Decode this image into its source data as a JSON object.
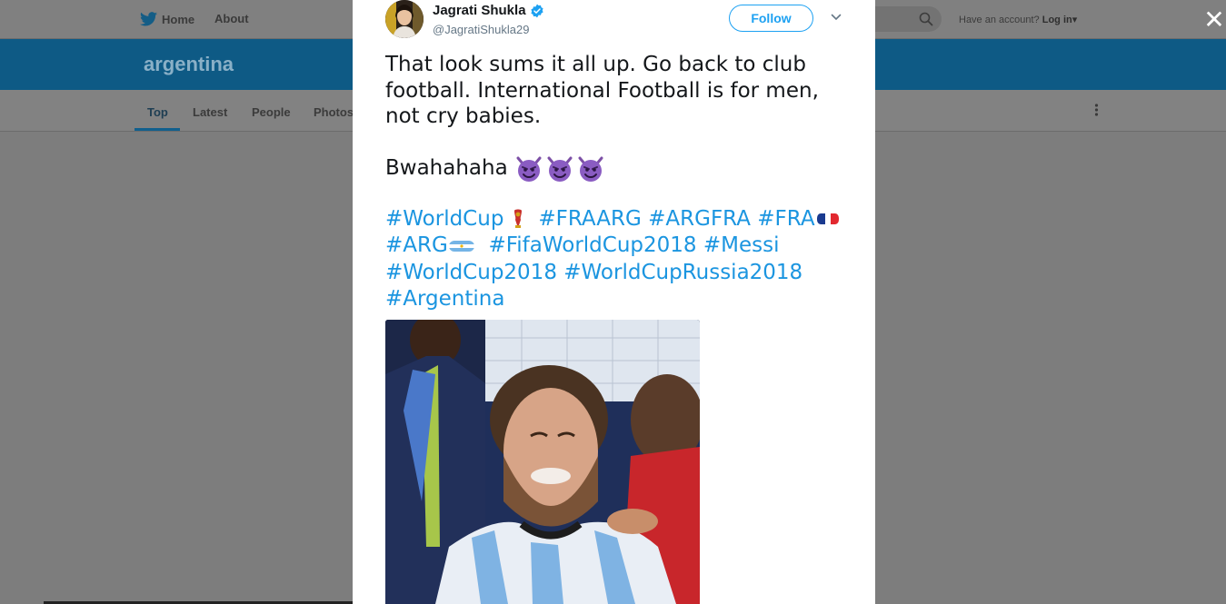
{
  "topnav": {
    "home_label": "Home",
    "about_label": "About",
    "account_prompt": "Have an account?",
    "login_label": "Log in"
  },
  "search": {
    "title": "argentina",
    "tabs": [
      "Top",
      "Latest",
      "People",
      "Photos"
    ],
    "active_tab": "Top"
  },
  "tweet": {
    "author_name": "Jagrati Shukla",
    "author_handle": "@JagratiShukla29",
    "follow_label": "Follow",
    "text_line1": "That look sums it all up. Go back to club football. International Football is for men, not cry babies.",
    "text_line2": "Bwahahaha",
    "emoji_count": 3,
    "hashtags": {
      "worldcup": "#WorldCup",
      "fraarg": "#FRAARG",
      "argfra": "#ARGFRA",
      "fra": "#FRA",
      "arg": "#ARG",
      "fifa2018": "#FifaWorldCup2018",
      "messi": "#Messi",
      "worldcup2018": "#WorldCup2018",
      "russia2018": "#WorldCupRussia2018",
      "argentina": "#Argentina"
    }
  },
  "colors": {
    "accent": "#1da1f2",
    "link": "#1b95e0",
    "banner_dimmed": "#0e5a85",
    "overlay": "#7d7d7d"
  },
  "icons": [
    "twitter-bird-icon",
    "search-icon",
    "close-icon",
    "verified-icon",
    "chevron-down-icon",
    "more-vertical-icon",
    "devil-emoji-icon",
    "trophy-emoji-icon",
    "france-flag-icon",
    "argentina-flag-icon"
  ]
}
